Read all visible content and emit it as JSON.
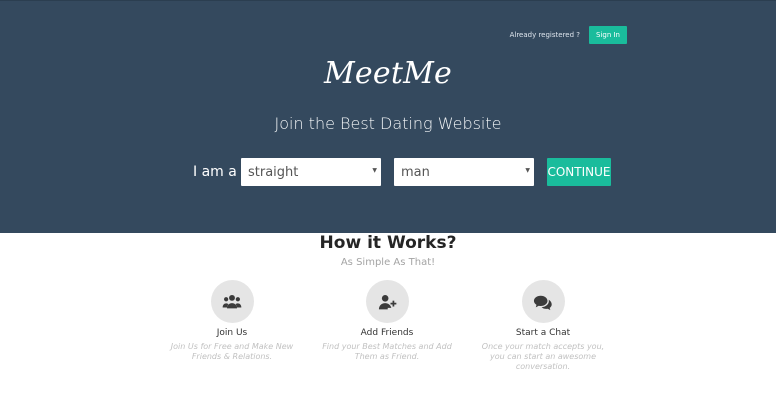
{
  "header": {
    "already_registered": "Already registered ?",
    "signin_label": "Sign In"
  },
  "hero": {
    "logo": "MeetMe",
    "tagline": "Join the Best Dating Website",
    "i_am_label": "I am a",
    "orientation_select": "straight",
    "gender_select": "man",
    "continue_label": "CONTINUE"
  },
  "how_it_works": {
    "title": "How it Works?",
    "subtitle": "As Simple As That!",
    "features": [
      {
        "icon": "users-icon",
        "title": "Join Us",
        "text": "Join Us for Free and Make New Friends & Relations."
      },
      {
        "icon": "user-plus-icon",
        "title": "Add Friends",
        "text": "Find your Best Matches and Add Them as Friend."
      },
      {
        "icon": "chat-icon",
        "title": "Start a Chat",
        "text": "Once your match accepts you, you can start an awesome conversation."
      }
    ]
  },
  "colors": {
    "hero_background": "#34495e",
    "accent": "#1abc9c",
    "feature_circle": "#e5e5e5"
  }
}
